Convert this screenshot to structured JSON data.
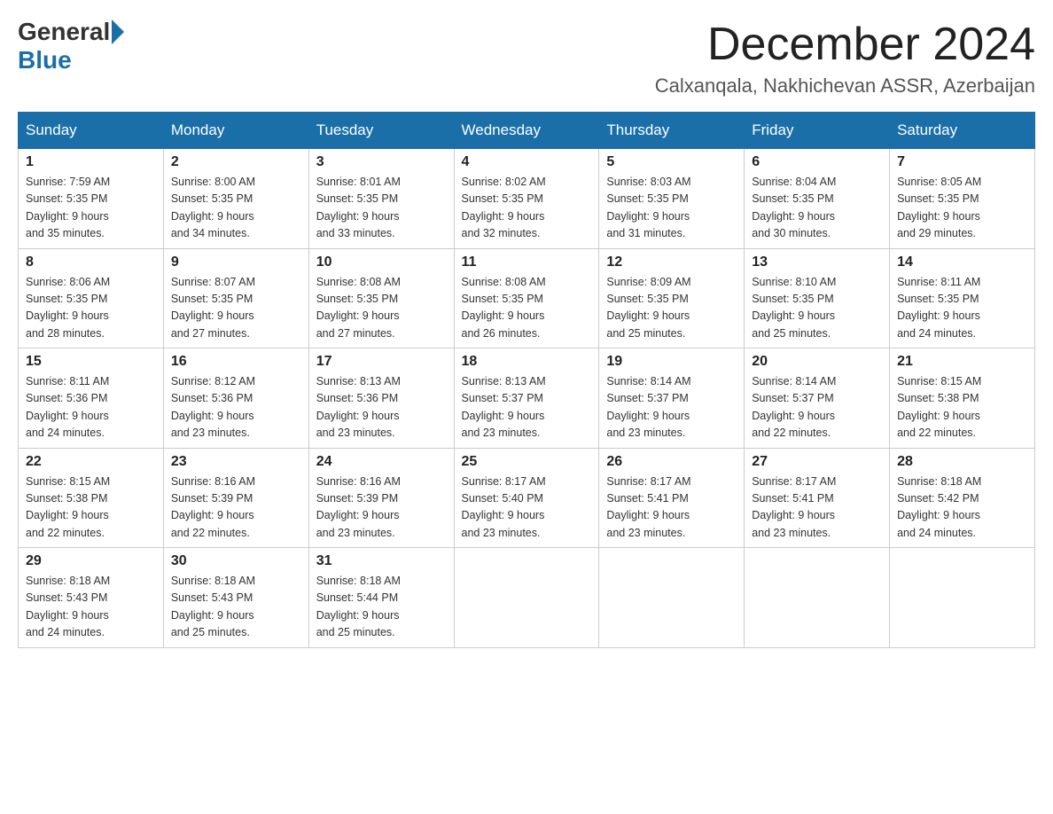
{
  "header": {
    "logo_general": "General",
    "logo_blue": "Blue",
    "month_year": "December 2024",
    "location": "Calxanqala, Nakhichevan ASSR, Azerbaijan"
  },
  "days_of_week": [
    "Sunday",
    "Monday",
    "Tuesday",
    "Wednesday",
    "Thursday",
    "Friday",
    "Saturday"
  ],
  "weeks": [
    [
      {
        "day": "1",
        "sunrise": "7:59 AM",
        "sunset": "5:35 PM",
        "daylight": "9 hours and 35 minutes."
      },
      {
        "day": "2",
        "sunrise": "8:00 AM",
        "sunset": "5:35 PM",
        "daylight": "9 hours and 34 minutes."
      },
      {
        "day": "3",
        "sunrise": "8:01 AM",
        "sunset": "5:35 PM",
        "daylight": "9 hours and 33 minutes."
      },
      {
        "day": "4",
        "sunrise": "8:02 AM",
        "sunset": "5:35 PM",
        "daylight": "9 hours and 32 minutes."
      },
      {
        "day": "5",
        "sunrise": "8:03 AM",
        "sunset": "5:35 PM",
        "daylight": "9 hours and 31 minutes."
      },
      {
        "day": "6",
        "sunrise": "8:04 AM",
        "sunset": "5:35 PM",
        "daylight": "9 hours and 30 minutes."
      },
      {
        "day": "7",
        "sunrise": "8:05 AM",
        "sunset": "5:35 PM",
        "daylight": "9 hours and 29 minutes."
      }
    ],
    [
      {
        "day": "8",
        "sunrise": "8:06 AM",
        "sunset": "5:35 PM",
        "daylight": "9 hours and 28 minutes."
      },
      {
        "day": "9",
        "sunrise": "8:07 AM",
        "sunset": "5:35 PM",
        "daylight": "9 hours and 27 minutes."
      },
      {
        "day": "10",
        "sunrise": "8:08 AM",
        "sunset": "5:35 PM",
        "daylight": "9 hours and 27 minutes."
      },
      {
        "day": "11",
        "sunrise": "8:08 AM",
        "sunset": "5:35 PM",
        "daylight": "9 hours and 26 minutes."
      },
      {
        "day": "12",
        "sunrise": "8:09 AM",
        "sunset": "5:35 PM",
        "daylight": "9 hours and 25 minutes."
      },
      {
        "day": "13",
        "sunrise": "8:10 AM",
        "sunset": "5:35 PM",
        "daylight": "9 hours and 25 minutes."
      },
      {
        "day": "14",
        "sunrise": "8:11 AM",
        "sunset": "5:35 PM",
        "daylight": "9 hours and 24 minutes."
      }
    ],
    [
      {
        "day": "15",
        "sunrise": "8:11 AM",
        "sunset": "5:36 PM",
        "daylight": "9 hours and 24 minutes."
      },
      {
        "day": "16",
        "sunrise": "8:12 AM",
        "sunset": "5:36 PM",
        "daylight": "9 hours and 23 minutes."
      },
      {
        "day": "17",
        "sunrise": "8:13 AM",
        "sunset": "5:36 PM",
        "daylight": "9 hours and 23 minutes."
      },
      {
        "day": "18",
        "sunrise": "8:13 AM",
        "sunset": "5:37 PM",
        "daylight": "9 hours and 23 minutes."
      },
      {
        "day": "19",
        "sunrise": "8:14 AM",
        "sunset": "5:37 PM",
        "daylight": "9 hours and 23 minutes."
      },
      {
        "day": "20",
        "sunrise": "8:14 AM",
        "sunset": "5:37 PM",
        "daylight": "9 hours and 22 minutes."
      },
      {
        "day": "21",
        "sunrise": "8:15 AM",
        "sunset": "5:38 PM",
        "daylight": "9 hours and 22 minutes."
      }
    ],
    [
      {
        "day": "22",
        "sunrise": "8:15 AM",
        "sunset": "5:38 PM",
        "daylight": "9 hours and 22 minutes."
      },
      {
        "day": "23",
        "sunrise": "8:16 AM",
        "sunset": "5:39 PM",
        "daylight": "9 hours and 22 minutes."
      },
      {
        "day": "24",
        "sunrise": "8:16 AM",
        "sunset": "5:39 PM",
        "daylight": "9 hours and 23 minutes."
      },
      {
        "day": "25",
        "sunrise": "8:17 AM",
        "sunset": "5:40 PM",
        "daylight": "9 hours and 23 minutes."
      },
      {
        "day": "26",
        "sunrise": "8:17 AM",
        "sunset": "5:41 PM",
        "daylight": "9 hours and 23 minutes."
      },
      {
        "day": "27",
        "sunrise": "8:17 AM",
        "sunset": "5:41 PM",
        "daylight": "9 hours and 23 minutes."
      },
      {
        "day": "28",
        "sunrise": "8:18 AM",
        "sunset": "5:42 PM",
        "daylight": "9 hours and 24 minutes."
      }
    ],
    [
      {
        "day": "29",
        "sunrise": "8:18 AM",
        "sunset": "5:43 PM",
        "daylight": "9 hours and 24 minutes."
      },
      {
        "day": "30",
        "sunrise": "8:18 AM",
        "sunset": "5:43 PM",
        "daylight": "9 hours and 25 minutes."
      },
      {
        "day": "31",
        "sunrise": "8:18 AM",
        "sunset": "5:44 PM",
        "daylight": "9 hours and 25 minutes."
      },
      null,
      null,
      null,
      null
    ]
  ],
  "labels": {
    "sunrise_prefix": "Sunrise: ",
    "sunset_prefix": "Sunset: ",
    "daylight_prefix": "Daylight: "
  }
}
